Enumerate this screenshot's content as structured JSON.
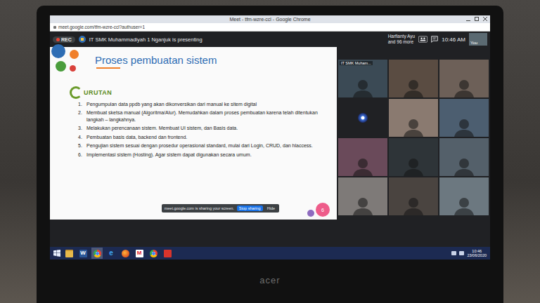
{
  "window": {
    "title": "Meet - tfm-wzre-ccl - Google Chrome",
    "url": "meet.google.com/tfm-wzre-ccl?authuser=1"
  },
  "meet_bar": {
    "rec": "REC",
    "presenting": "IT SMK Muhammadiyah 1 Nganjuk is presenting",
    "participants": [
      "Harfianty Ayu",
      "and 96 more"
    ],
    "time": "10:46 AM",
    "self_label": "You"
  },
  "slide": {
    "title": "Proses pembuatan sistem",
    "heading": "URUTAN",
    "page": "6",
    "steps": [
      {
        "n": "1.",
        "text": "Pengumpulan data ppdb yang akan dikonversikan dari manual ke sitem digital"
      },
      {
        "n": "2.",
        "text": "Membuat sketsa manual (Algoritma/Alur). Memudahkan dalam proses pembuatan karena telah ditentukan langkah – langkahnya."
      },
      {
        "n": "3.",
        "text": "Melakukan perencanaan sistem. Membuat UI sistem, dan Basis data."
      },
      {
        "n": "4.",
        "text": "Pembuatan basis data, backend dan frontend."
      },
      {
        "n": "5.",
        "text": "Pengujian sistem sesuai dengan prosedur operasional standard, mulai dari Login, CRUD, dan hlaccess."
      },
      {
        "n": "6.",
        "text": "Implementasi sistem (Hosting). Agar sistem dapat digunakan secara umum."
      }
    ]
  },
  "share_toast": {
    "message": "meet.google.com is sharing your screen.",
    "stop": "Stop sharing",
    "hide": "Hide"
  },
  "gallery": {
    "tiles": [
      {
        "kind": "video",
        "label": "IT SMK Muham..."
      },
      {
        "kind": "video"
      },
      {
        "kind": "video"
      },
      {
        "kind": "avatar"
      },
      {
        "kind": "video"
      },
      {
        "kind": "video"
      },
      {
        "kind": "video"
      },
      {
        "kind": "video"
      },
      {
        "kind": "video"
      },
      {
        "kind": "video"
      },
      {
        "kind": "video"
      },
      {
        "kind": "video"
      }
    ]
  },
  "taskbar": {
    "apps": [
      {
        "kind": "explorer",
        "selected": false
      },
      {
        "kind": "word",
        "glyph": "W",
        "selected": false
      },
      {
        "kind": "chrome",
        "selected": true
      },
      {
        "kind": "ie",
        "glyph": "e",
        "selected": false
      },
      {
        "kind": "firefox",
        "selected": false
      },
      {
        "kind": "mendeley",
        "glyph": "M",
        "selected": false
      },
      {
        "kind": "chrome",
        "selected": false
      },
      {
        "kind": "pdf",
        "selected": false
      }
    ],
    "time": "10:46",
    "date": "23/06/2020"
  },
  "device": {
    "brand": "acer"
  }
}
